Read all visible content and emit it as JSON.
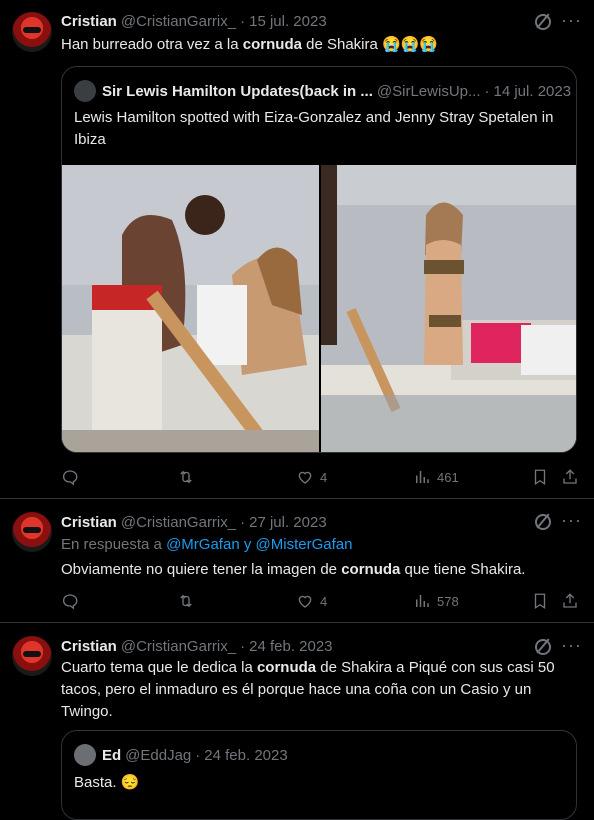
{
  "tweets": [
    {
      "name": "Cristian",
      "handle": "@CristianGarrix_",
      "sep": "·",
      "date": "15 jul. 2023",
      "text_parts": [
        "Han burreado otra vez a la ",
        "cornuda",
        " de Shakira ",
        "😭😭😭"
      ],
      "quote": {
        "name": "Sir Lewis Hamilton Updates(back in ...",
        "handle": "@SirLewisUp...",
        "sep": "·",
        "date": "14 jul. 2023",
        "text": "Lewis Hamilton spotted with Eiza-Gonzalez and Jenny Stray Spetalen in Ibiza"
      },
      "actions": {
        "reply": "",
        "retweet": "",
        "like": "4",
        "views": "461"
      }
    },
    {
      "name": "Cristian",
      "handle": "@CristianGarrix_",
      "sep": "·",
      "date": "27 jul. 2023",
      "reply_prefix": "En respuesta a ",
      "reply_user1": "@MrGafan",
      "reply_and": " y ",
      "reply_user2": "@MisterGafan",
      "text_parts": [
        "Obviamente no quiere tener la imagen de ",
        "cornuda",
        " que tiene Shakira."
      ],
      "actions": {
        "reply": "",
        "retweet": "",
        "like": "4",
        "views": "578"
      }
    },
    {
      "name": "Cristian",
      "handle": "@CristianGarrix_",
      "sep": "·",
      "date": "24 feb. 2023",
      "text_parts": [
        "Cuarto tema que le dedica la ",
        "cornuda",
        " de Shakira a Piqué con sus casi 50 tacos, pero el inmaduro es él porque hace una coña con un Casio y un Twingo."
      ],
      "quote": {
        "name": "Ed",
        "handle": "@EddJag",
        "sep": "·",
        "date": "24 feb. 2023",
        "text": "Basta. 😔"
      }
    }
  ],
  "colors": {
    "background": "#000000",
    "text": "#e7e9ea",
    "muted": "#71767b",
    "link": "#1d9bf0",
    "border": "#2f3336"
  },
  "icons": [
    "reply-icon",
    "retweet-icon",
    "like-icon",
    "views-icon",
    "bookmark-icon",
    "share-icon",
    "grok-icon",
    "more-icon"
  ]
}
